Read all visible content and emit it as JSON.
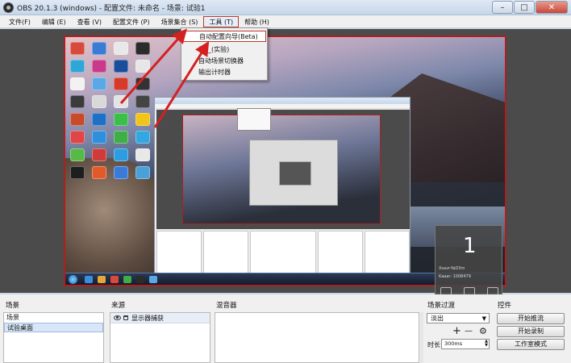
{
  "window": {
    "title": "OBS 20.1.3 (windows) - 配置文件: 未命名 - 场景: 试验1",
    "controls": [
      "–",
      "□",
      "✕"
    ]
  },
  "menu": {
    "items": [
      "文件(F)",
      "编辑 (E)",
      "查看 (V)",
      "配置文件 (P)",
      "场景集合 (S)",
      "工具 (T)",
      "帮助 (H)"
    ],
    "active_index": 5
  },
  "tools_menu": {
    "items": [
      "自动配置向导(Beta)",
      "标__(实验)",
      "自动场景切换器",
      "输出计时器"
    ],
    "highlighted_index": 0
  },
  "preview": {
    "widget_time": "1",
    "widget_lines": [
      "Xsavr-YaD3m",
      "Kaaar: 1008479"
    ]
  },
  "docks": {
    "scenes": {
      "header": "场景",
      "items": [
        "场景",
        "试验桌面"
      ],
      "selected_index": 1
    },
    "sources": {
      "header": "来源",
      "items": [
        "显示器捕获"
      ]
    },
    "mixer": {
      "header": "混音器"
    },
    "transitions": {
      "header": "场景过渡",
      "selected": "淡出",
      "add_label": "+",
      "remove_label": "—",
      "duration_label": "时长",
      "duration_value": "300ms"
    },
    "controls": {
      "header": "控件",
      "buttons": [
        "开始推流",
        "开始录制",
        "工作室模式"
      ]
    }
  },
  "colors": {
    "accent_red": "#b01e1e",
    "preview_bg": "#4b4b4b",
    "selection": "#d8e6f7"
  }
}
